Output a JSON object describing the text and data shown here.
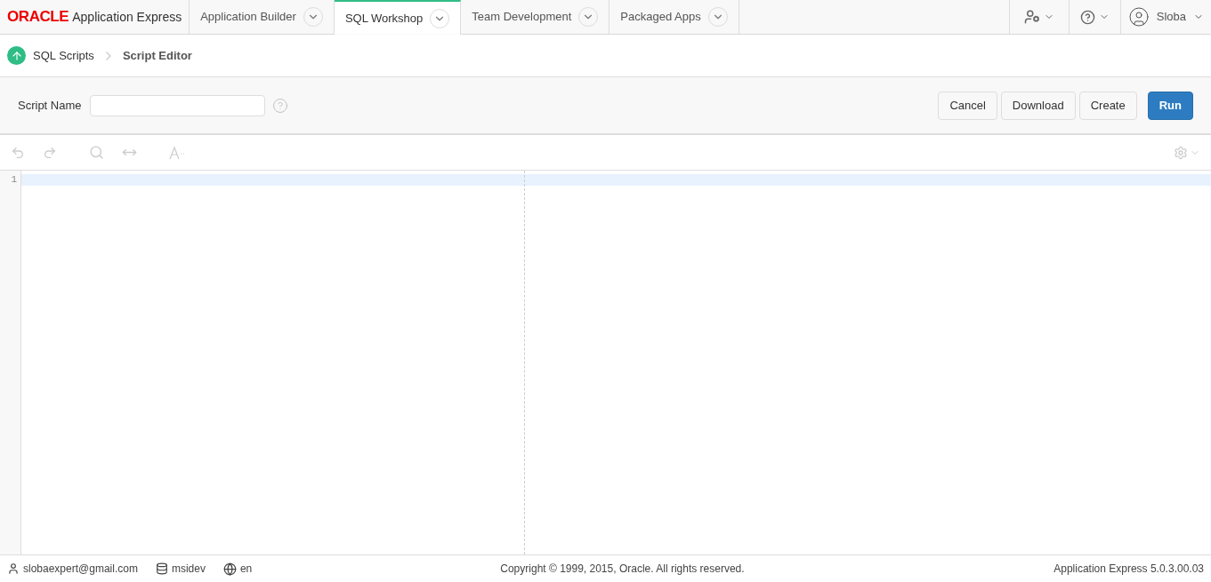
{
  "brand": {
    "logo": "ORACLE",
    "product": "Application Express"
  },
  "tabs": [
    {
      "label": "Application Builder",
      "selected": false
    },
    {
      "label": "SQL Workshop",
      "selected": true
    },
    {
      "label": "Team Development",
      "selected": false
    },
    {
      "label": "Packaged Apps",
      "selected": false
    }
  ],
  "user": {
    "name": "Sloba"
  },
  "breadcrumb": [
    {
      "label": "SQL Scripts",
      "current": false
    },
    {
      "label": "Script Editor",
      "current": true
    }
  ],
  "form": {
    "label": "Script Name"
  },
  "buttons": [
    {
      "label": "Cancel",
      "kind": "default"
    },
    {
      "label": "Download",
      "kind": "default"
    },
    {
      "label": "Create",
      "kind": "default"
    },
    {
      "label": "Run",
      "kind": "primary"
    }
  ],
  "editor": {
    "line_numbers": [
      "1"
    ]
  },
  "footer": {
    "user": "slobaexpert@gmail.com",
    "workspace": "msidev",
    "language": "en",
    "copyright": "Copyright © 1999, 2015, Oracle. All rights reserved.",
    "version": "Application Express 5.0.3.00.03"
  }
}
